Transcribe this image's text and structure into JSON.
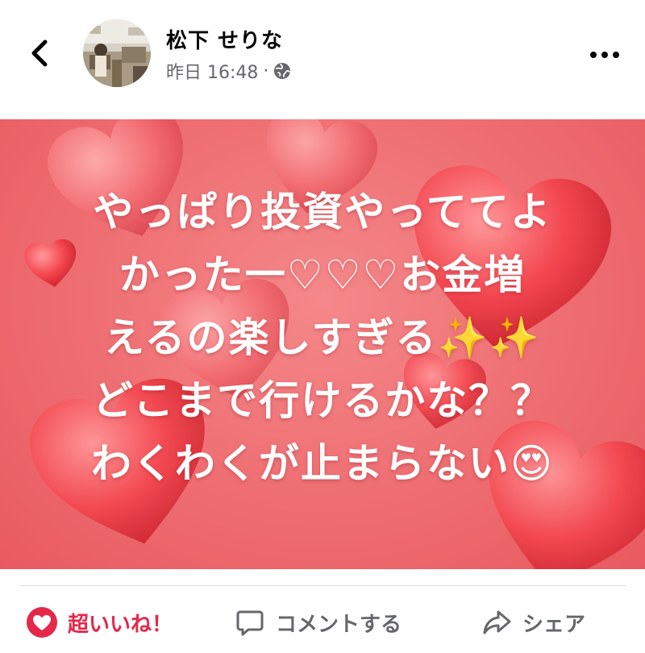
{
  "header": {
    "author_name": "松下 せりな",
    "timestamp": "昨日 16:48",
    "separator": "·",
    "privacy_icon": "globe-icon",
    "back_icon": "chevron-left-icon",
    "more_icon": "more-horizontal-icon"
  },
  "post": {
    "lines": [
      "やっぱり投資やっててよ",
      "かった一♡♡♡お金増",
      "えるの楽しすぎる✨✨",
      "どこまで行けるかな？？",
      "わくわくが止まらない😍"
    ],
    "background_color": "#ee6d71",
    "text_color": "#ffffff"
  },
  "actions": {
    "like_label": "超いいね！",
    "like_icon": "heart-icon",
    "like_color": "#e4284a",
    "comment_label": "コメントする",
    "comment_icon": "comment-icon",
    "share_label": "シェア",
    "share_icon": "share-icon"
  }
}
